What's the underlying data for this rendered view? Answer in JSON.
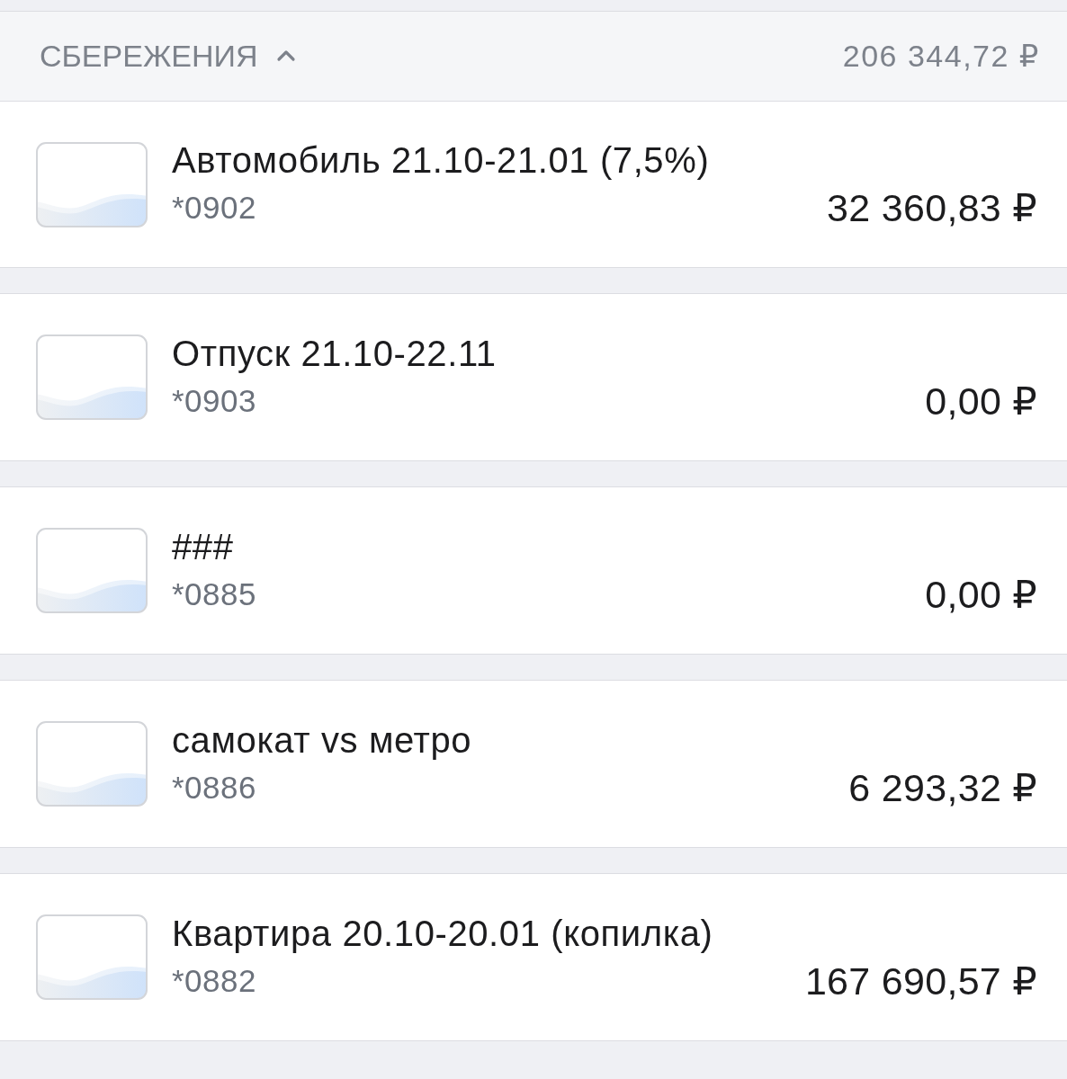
{
  "section": {
    "title": "СБЕРЕЖЕНИЯ",
    "expanded": true,
    "total": "206 344,72 ₽"
  },
  "accounts": [
    {
      "name": "Автомобиль 21.10-21.01 (7,5%)",
      "number": "*0902",
      "balance": "32 360,83 ₽"
    },
    {
      "name": "Отпуск 21.10-22.11",
      "number": "*0903",
      "balance": "0,00 ₽"
    },
    {
      "name": "###",
      "number": "*0885",
      "balance": "0,00 ₽"
    },
    {
      "name": "самокат vs метро",
      "number": "*0886",
      "balance": "6 293,32 ₽"
    },
    {
      "name": "Квартира 20.10-20.01 (копилка)",
      "number": "*0882",
      "balance": "167 690,57 ₽"
    }
  ]
}
